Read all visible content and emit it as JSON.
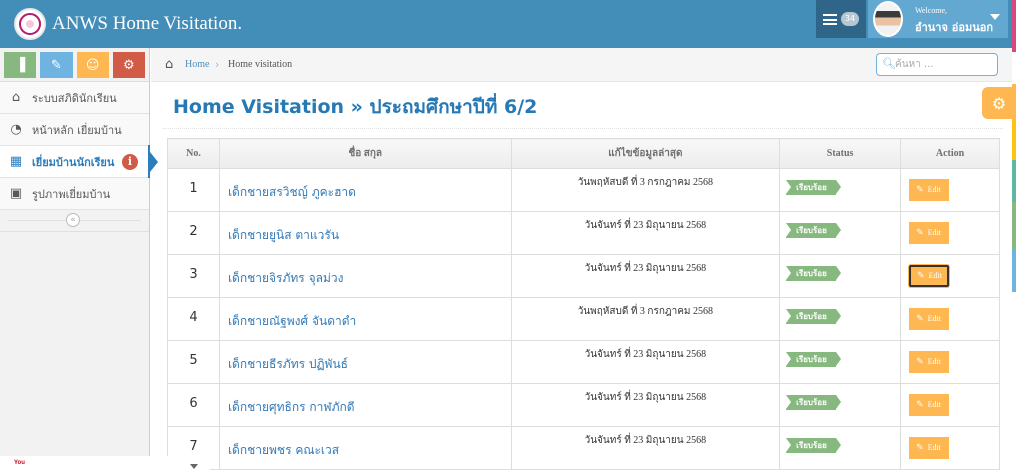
{
  "brand": {
    "title": "ANWS Home Visitation."
  },
  "user": {
    "welcome": "Welcome,",
    "name": "อำนาจ อ่อมนอก",
    "message_count": "34"
  },
  "sidebar": {
    "shortcuts": [
      {
        "icon": "signal-icon",
        "color": "#87b87f"
      },
      {
        "icon": "pencil-icon",
        "color": "#6fb3e0"
      },
      {
        "icon": "users-icon",
        "color": "#ffb752"
      },
      {
        "icon": "cogs-icon",
        "color": "#d15b47"
      }
    ],
    "items": [
      {
        "label": "ระบบสภิดินักเรียน",
        "icon": "home-icon",
        "active": false
      },
      {
        "label": "หน้าหลัก เยี่ยมบ้าน",
        "icon": "dashboard-icon",
        "active": false
      },
      {
        "label": "เยี่ยมบ้านนักเรียน",
        "icon": "calendar-icon",
        "active": true,
        "badge": "i"
      },
      {
        "label": "รูปภาพเยี่ยมบ้าน",
        "icon": "picture-icon",
        "active": false
      }
    ]
  },
  "breadcrumb": {
    "home": "Home",
    "current": "Home visitation"
  },
  "search": {
    "placeholder": "ค้นหา ..."
  },
  "page": {
    "title": "Home Visitation » ประถมศึกษาปีที่ 6/2"
  },
  "table": {
    "headers": [
      "No.",
      "ชื่อ สกุล",
      "แก้ไขข้อมูลล่าสุด",
      "Status",
      "Action"
    ],
    "rows": [
      {
        "no": "1",
        "name": "เด็กชายสรวิชญ์ ภูคะฮาด",
        "updated": "วันพฤหัสบดี ที่ 3 กรกฎาคม 2568",
        "status": "เรียบร้อย",
        "action": "Edit"
      },
      {
        "no": "2",
        "name": "เด็กชายยูนิส ตาแวรัน",
        "updated": "วันจันทร์ ที่ 23 มิถุนายน 2568",
        "status": "เรียบร้อย",
        "action": "Edit"
      },
      {
        "no": "3",
        "name": "เด็กชายจิรภัทร จุลม่วง",
        "updated": "วันจันทร์ ที่ 23 มิถุนายน 2568",
        "status": "เรียบร้อย",
        "action": "Edit"
      },
      {
        "no": "4",
        "name": "เด็กชายณัฐพงศ์ จันดาดำ",
        "updated": "วันพฤหัสบดี ที่ 3 กรกฎาคม 2568",
        "status": "เรียบร้อย",
        "action": "Edit"
      },
      {
        "no": "5",
        "name": "เด็กชายธีรภัทร ปฏิพันธ์",
        "updated": "วันจันทร์ ที่ 23 มิถุนายน 2568",
        "status": "เรียบร้อย",
        "action": "Edit"
      },
      {
        "no": "6",
        "name": "เด็กชายศุทธิกร กาฬภักดี",
        "updated": "วันจันทร์ ที่ 23 มิถุนายน 2568",
        "status": "เรียบร้อย",
        "action": "Edit"
      },
      {
        "no": "7",
        "name": "เด็กชายพชร คณะเวส",
        "updated": "วันจันทร์ ที่ 23 มิถุนายน 2568",
        "status": "เรียบร้อย",
        "action": "Edit"
      }
    ]
  },
  "bottom": {
    "logo_text": "You"
  },
  "colors": {
    "header": "#438eb9",
    "accent": "#2b7dbc",
    "status_green": "#87b87f",
    "edit_orange": "#ffb752",
    "edge_strips": [
      "#d6487e",
      "#ffffff",
      "#ffb752",
      "#ffc20e",
      "#5fb7a4",
      "#87b87f",
      "#6fb3e0",
      "#ffffff"
    ]
  }
}
